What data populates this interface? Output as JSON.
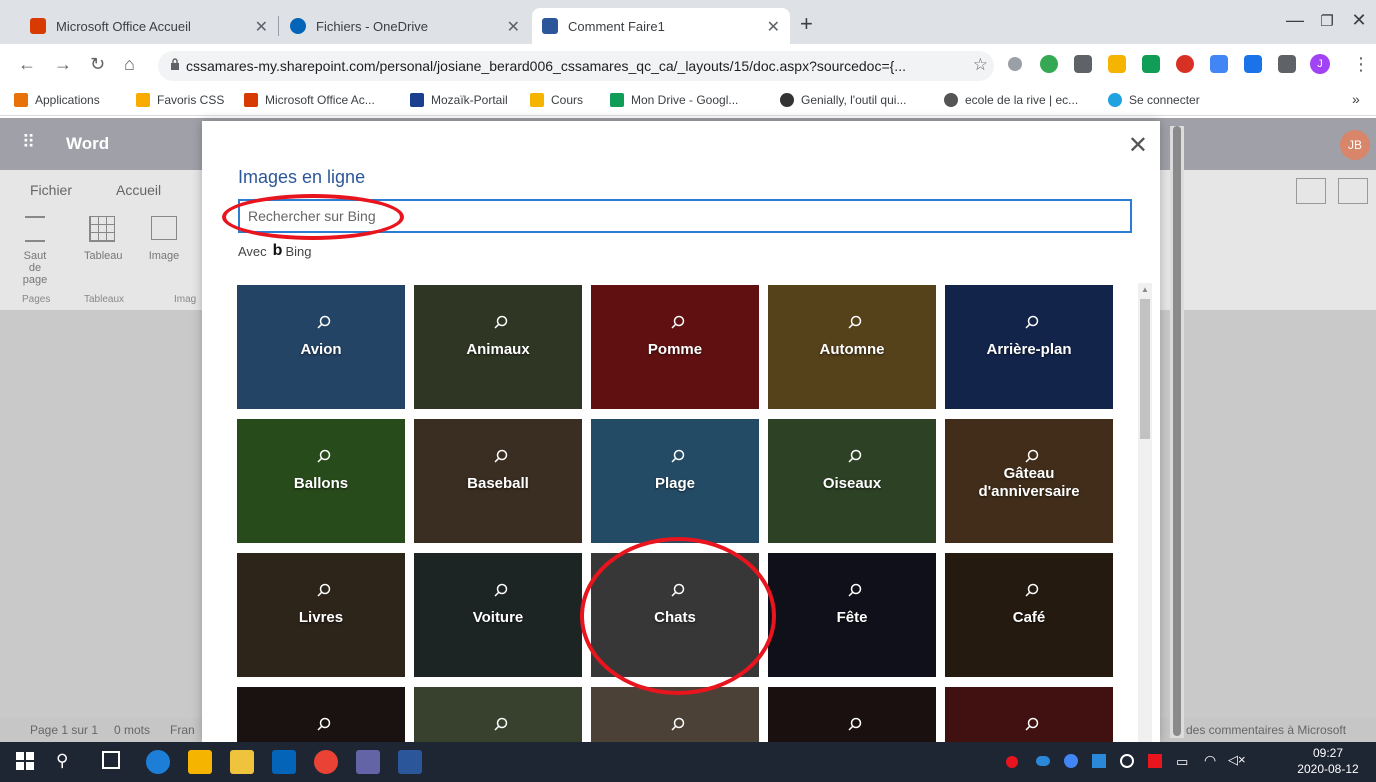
{
  "browser": {
    "tabs": [
      {
        "title": "Microsoft Office Accueil",
        "color": "#d83b01"
      },
      {
        "title": "Fichiers - OneDrive",
        "color": "#0364b8"
      },
      {
        "title": "Comment Faire1",
        "color": "#2b579a"
      }
    ],
    "new_tab": "+",
    "url": "cssamares-my.sharepoint.com/personal/josiane_berard006_cssamares_qc_ca/_layouts/15/doc.aspx?sourcedoc={...",
    "profile_initial": "J",
    "bookmarks": [
      {
        "label": "Applications",
        "color": "#e8710a"
      },
      {
        "label": "Favoris CSS",
        "color": "#f9ab00"
      },
      {
        "label": "Microsoft Office Ac...",
        "color": "#d83b01"
      },
      {
        "label": "Mozaïk-Portail",
        "color": "#1a3f8f"
      },
      {
        "label": "Cours",
        "color": "#f4b400"
      },
      {
        "label": "Mon Drive - Googl...",
        "color": "#0f9d58"
      },
      {
        "label": "Genially, l'outil qui...",
        "color": "#333333"
      },
      {
        "label": "ecole de la rive | ec...",
        "color": "#555555"
      },
      {
        "label": "Se connecter",
        "color": "#1fa3e0"
      }
    ],
    "bookmarks_more": "»"
  },
  "word": {
    "app_name": "Word",
    "user_initials": "JB",
    "ribbon_tabs": [
      "Fichier",
      "Accueil"
    ],
    "ribbon_buttons": [
      {
        "label": "Saut de page",
        "group": "Pages"
      },
      {
        "label": "Tableau",
        "group": "Tableaux"
      },
      {
        "label": "Image",
        "group": "Imag"
      }
    ],
    "status_left": "Page 1 sur 1",
    "status_words": "0 mots",
    "status_lang": "Fran",
    "status_right": "des commentaires à Microsoft"
  },
  "dialog": {
    "title": "Images en ligne",
    "search_placeholder": "Rechercher sur Bing",
    "powered_prefix": "Avec",
    "powered_brand": "Bing",
    "tiles": [
      {
        "label": "Avion",
        "color": "#3a6ea5"
      },
      {
        "label": "Animaux",
        "color": "#4d5a3a"
      },
      {
        "label": "Pomme",
        "color": "#9b1b1b"
      },
      {
        "label": "Automne",
        "color": "#8a6a2a"
      },
      {
        "label": "Arrière-plan",
        "color": "#1f3a7a"
      },
      {
        "label": "Ballons",
        "color": "#3f7a2a"
      },
      {
        "label": "Baseball",
        "color": "#5e4a36"
      },
      {
        "label": "Plage",
        "color": "#3a7aa5"
      },
      {
        "label": "Oiseaux",
        "color": "#4a6a3a"
      },
      {
        "label": "Gâteau d'anniversaire",
        "color": "#6a4a2a"
      },
      {
        "label": "Livres",
        "color": "#4a3a2a"
      },
      {
        "label": "Voiture",
        "color": "#2e3a3a"
      },
      {
        "label": "Chats",
        "color": "#5a5a5a"
      },
      {
        "label": "Fête",
        "color": "#1a1a2a"
      },
      {
        "label": "Café",
        "color": "#3a2a1a"
      },
      {
        "label": "",
        "color": "#2a1e1a"
      },
      {
        "label": "",
        "color": "#5a6a4a"
      },
      {
        "label": "",
        "color": "#7a6a5a"
      },
      {
        "label": "",
        "color": "#2a1a1a"
      },
      {
        "label": "",
        "color": "#6a1a1a"
      }
    ]
  },
  "taskbar": {
    "time": "09:27",
    "date": "2020-08-12"
  },
  "colors": {
    "accent": "#2b579a",
    "annotation": "#e8141e"
  }
}
